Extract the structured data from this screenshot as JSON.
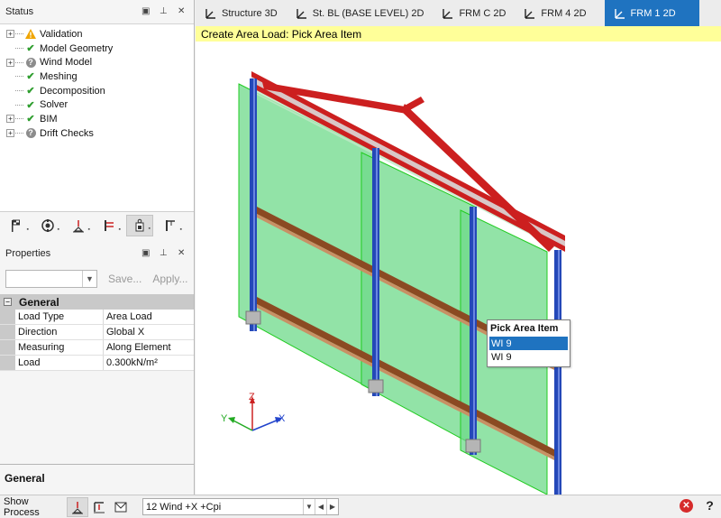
{
  "status_panel": {
    "title": "Status",
    "controls": {
      "dropdown": "▣",
      "pin": "⊥",
      "close": "✕"
    },
    "items": [
      {
        "label": "Validation",
        "state": "warning",
        "expandable": true
      },
      {
        "label": "Model Geometry",
        "state": "ok",
        "expandable": false
      },
      {
        "label": "Wind Model",
        "state": "unknown",
        "expandable": true
      },
      {
        "label": "Meshing",
        "state": "ok",
        "expandable": false
      },
      {
        "label": "Decomposition",
        "state": "ok",
        "expandable": false
      },
      {
        "label": "Solver",
        "state": "ok",
        "expandable": false
      },
      {
        "label": "BIM",
        "state": "ok",
        "expandable": true
      },
      {
        "label": "Drift Checks",
        "state": "unknown",
        "expandable": true
      }
    ],
    "toolbar_icons": [
      "flags-icon",
      "globe-gear-icon",
      "support-icon",
      "frame-icon",
      "weight-icon",
      "column-icon"
    ],
    "active_toolbar_index": 4
  },
  "properties_panel": {
    "title": "Properties",
    "controls": {
      "dropdown": "▣",
      "pin": "⊥",
      "close": "✕"
    },
    "preset_select_value": "",
    "save_label": "Save...",
    "apply_label": "Apply...",
    "category": "General",
    "rows": [
      {
        "key": "Load Type",
        "value": "Area Load"
      },
      {
        "key": "Direction",
        "value": "Global X"
      },
      {
        "key": "Measuring",
        "value": "Along Element"
      },
      {
        "key": "Load",
        "value": "0.300kN/m²"
      }
    ],
    "footer_label": "General"
  },
  "tabs": [
    {
      "label": "Structure 3D",
      "active": false
    },
    {
      "label": "St. BL (BASE LEVEL) 2D",
      "active": false
    },
    {
      "label": "FRM C 2D",
      "active": false
    },
    {
      "label": "FRM 4 2D",
      "active": false
    },
    {
      "label": "FRM 1 2D",
      "active": true
    }
  ],
  "viewport": {
    "prompt": "Create Area Load: Pick Area Item",
    "axes": {
      "z": "Z",
      "y": "Y",
      "x": "X"
    },
    "pick_popup": {
      "title": "Pick Area Item",
      "items": [
        "WI 9",
        "WI 9"
      ],
      "selected_index": 0
    }
  },
  "bottom_bar": {
    "show_process_label": "Show Process",
    "load_case_value": "12 Wind +X +Cpi",
    "close_label": "✕",
    "help_label": "?"
  },
  "colors": {
    "accent": "#1f73c0",
    "prompt_bg": "#ffff99",
    "beam_red": "#cc1f1f",
    "column_blue": "#2448b8",
    "panel_green": "#6ed98a",
    "panel_outline": "#22cc22",
    "girt_brown": "#8b4a22"
  }
}
